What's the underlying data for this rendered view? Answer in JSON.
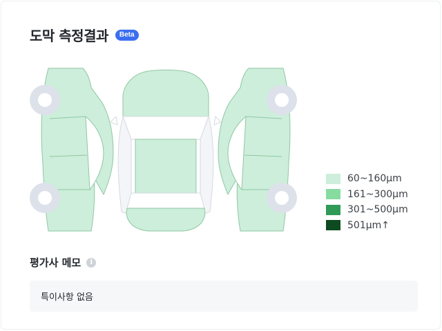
{
  "header": {
    "title": "도막 측정결과",
    "badge": "Beta"
  },
  "diagram": {
    "panel_color": "#cdeedb",
    "stroke_color": "#6fae86",
    "glass_color": "#ffffff",
    "tire_color": "#d6dbe5",
    "panel_thickness_range": "60~160μm"
  },
  "legend": {
    "items": [
      {
        "label": "60~160μm",
        "color": "#cdeedb"
      },
      {
        "label": "161~300μm",
        "color": "#86dca0"
      },
      {
        "label": "301~500μm",
        "color": "#2f9b56"
      },
      {
        "label": "501μm↑",
        "color": "#0d4a1f"
      }
    ]
  },
  "memo": {
    "title": "평가사 메모",
    "info_icon": "info-icon",
    "text": "특이사항 없음"
  }
}
